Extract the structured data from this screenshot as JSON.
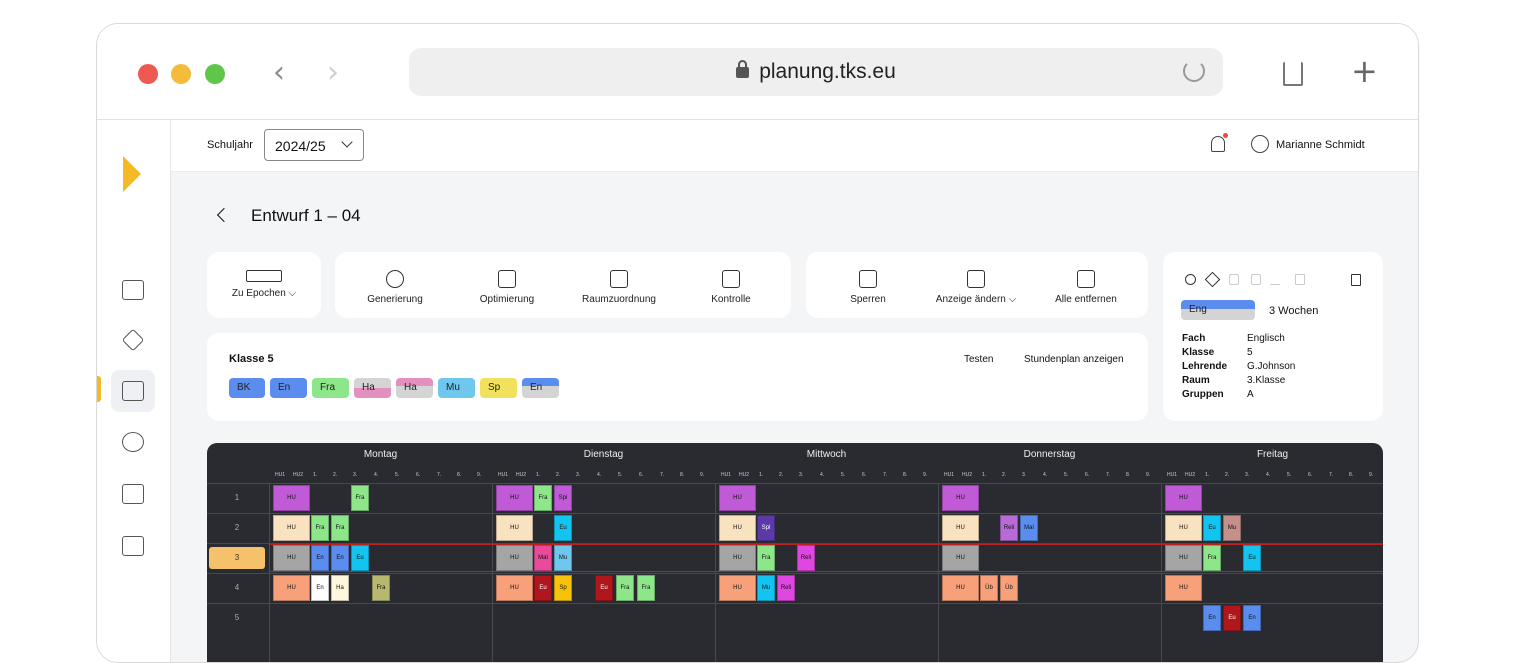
{
  "browser": {
    "url": "planung.tks.eu"
  },
  "topbar": {
    "year_label": "Schuljahr",
    "year_value": "2024/25",
    "user_name": "Marianne Schmidt"
  },
  "page": {
    "title": "Entwurf 1 – 04"
  },
  "toolbar": {
    "group1": [
      {
        "label": "Zu Epochen ⌵"
      }
    ],
    "group2": [
      {
        "label": "Generierung"
      },
      {
        "label": "Optimierung"
      },
      {
        "label": "Raumzuordnung"
      },
      {
        "label": "Kontrolle"
      }
    ],
    "group3": [
      {
        "label": "Sperren"
      },
      {
        "label": "Anzeige ändern ⌵"
      },
      {
        "label": "Alle entfernen"
      }
    ]
  },
  "class_panel": {
    "title": "Klasse 5",
    "actions": [
      "Testen",
      "Stundenplan anzeigen"
    ],
    "subjects": [
      {
        "label": "BK",
        "color": "#5b8def"
      },
      {
        "label": "En",
        "color": "#5b8def"
      },
      {
        "label": "Fra",
        "color": "#8ee68a"
      },
      {
        "label": "Ha",
        "color": "#e38fc0"
      },
      {
        "label": "Ha",
        "color": "#e38fc0"
      },
      {
        "label": "Mu",
        "color": "#6fc7ee"
      },
      {
        "label": "Sp",
        "color": "#f2e15c"
      },
      {
        "label": "En",
        "color": "#5b8def"
      }
    ]
  },
  "detail": {
    "chip": "Eng",
    "duration": "3 Wochen",
    "fields": [
      {
        "key": "Fach",
        "value": "Englisch"
      },
      {
        "key": "Klasse",
        "value": "5"
      },
      {
        "key": "Lehrende",
        "value": "G.Johnson"
      },
      {
        "key": "Raum",
        "value": "3.Klasse"
      },
      {
        "key": "Gruppen",
        "value": "A"
      }
    ]
  },
  "timetable": {
    "days": [
      "Montag",
      "Dienstag",
      "Mittwoch",
      "Donnerstag",
      "Freitag"
    ],
    "columns": [
      "HU1",
      "HU2",
      "1.",
      "2.",
      "3.",
      "4.",
      "5.",
      "6.",
      "7.",
      "8.",
      "9."
    ],
    "rows": [
      "1",
      "2",
      "3",
      "4",
      "5"
    ],
    "entries": [
      {
        "day": 0,
        "row": 0,
        "col": 0,
        "label": "HU",
        "color": "#c15ad6"
      },
      {
        "day": 0,
        "row": 0,
        "col": 4,
        "label": "Fra",
        "color": "#8ee68a"
      },
      {
        "day": 0,
        "row": 1,
        "col": 0,
        "label": "HU",
        "color": "#f9e2c0"
      },
      {
        "day": 0,
        "row": 1,
        "col": 2,
        "label": "Fra",
        "color": "#8ee68a"
      },
      {
        "day": 0,
        "row": 1,
        "col": 3,
        "label": "Fra",
        "color": "#8ee68a"
      },
      {
        "day": 0,
        "row": 2,
        "col": 0,
        "label": "HU",
        "color": "#a5a5a5"
      },
      {
        "day": 0,
        "row": 2,
        "col": 2,
        "label": "En",
        "color": "#5b8def"
      },
      {
        "day": 0,
        "row": 2,
        "col": 3,
        "label": "En",
        "color": "#5b8def"
      },
      {
        "day": 0,
        "row": 2,
        "col": 4,
        "label": "Eu",
        "color": "#13c4f0"
      },
      {
        "day": 0,
        "row": 3,
        "col": 0,
        "label": "HU",
        "color": "#f7a07a"
      },
      {
        "day": 0,
        "row": 3,
        "col": 2,
        "label": "En",
        "color": "#ffffff"
      },
      {
        "day": 0,
        "row": 3,
        "col": 3,
        "label": "Ha",
        "color": "#fff7dd"
      },
      {
        "day": 0,
        "row": 3,
        "col": 5,
        "label": "Fra",
        "color": "#b7b870"
      },
      {
        "day": 1,
        "row": 0,
        "col": 0,
        "label": "HU",
        "color": "#c15ad6"
      },
      {
        "day": 1,
        "row": 0,
        "col": 2,
        "label": "Fra",
        "color": "#8ee68a"
      },
      {
        "day": 1,
        "row": 0,
        "col": 3,
        "label": "Spi",
        "color": "#c15ad6"
      },
      {
        "day": 1,
        "row": 1,
        "col": 0,
        "label": "HU",
        "color": "#f9e2c0"
      },
      {
        "day": 1,
        "row": 1,
        "col": 3,
        "label": "Eu",
        "color": "#13c4f0"
      },
      {
        "day": 1,
        "row": 2,
        "col": 0,
        "label": "HU",
        "color": "#a5a5a5"
      },
      {
        "day": 1,
        "row": 2,
        "col": 2,
        "label": "Mal",
        "color": "#e84b9a"
      },
      {
        "day": 1,
        "row": 2,
        "col": 3,
        "label": "Mu",
        "color": "#6fc7ee"
      },
      {
        "day": 1,
        "row": 3,
        "col": 0,
        "label": "HU",
        "color": "#f7a07a"
      },
      {
        "day": 1,
        "row": 3,
        "col": 2,
        "label": "Eu",
        "color": "#b0171c"
      },
      {
        "day": 1,
        "row": 3,
        "col": 3,
        "label": "Sp",
        "color": "#f7c20a"
      },
      {
        "day": 1,
        "row": 3,
        "col": 5,
        "label": "Eu",
        "color": "#b0171c"
      },
      {
        "day": 1,
        "row": 3,
        "col": 6,
        "label": "Fra",
        "color": "#8ee68a"
      },
      {
        "day": 1,
        "row": 3,
        "col": 7,
        "label": "Fra",
        "color": "#8ee68a"
      },
      {
        "day": 2,
        "row": 0,
        "col": 0,
        "label": "HU",
        "color": "#c15ad6"
      },
      {
        "day": 2,
        "row": 1,
        "col": 0,
        "label": "HU",
        "color": "#f9e2c0"
      },
      {
        "day": 2,
        "row": 1,
        "col": 2,
        "label": "Spl",
        "color": "#5b3aa8"
      },
      {
        "day": 2,
        "row": 2,
        "col": 0,
        "label": "HU",
        "color": "#a5a5a5"
      },
      {
        "day": 2,
        "row": 2,
        "col": 2,
        "label": "Fra",
        "color": "#8ee68a"
      },
      {
        "day": 2,
        "row": 2,
        "col": 4,
        "label": "Reli",
        "color": "#e046e0"
      },
      {
        "day": 2,
        "row": 3,
        "col": 0,
        "label": "HU",
        "color": "#f7a07a"
      },
      {
        "day": 2,
        "row": 3,
        "col": 2,
        "label": "Mu",
        "color": "#13c4f0"
      },
      {
        "day": 2,
        "row": 3,
        "col": 3,
        "label": "Reli",
        "color": "#e046e0"
      },
      {
        "day": 3,
        "row": 0,
        "col": 0,
        "label": "HU",
        "color": "#c15ad6"
      },
      {
        "day": 3,
        "row": 1,
        "col": 0,
        "label": "HU",
        "color": "#f9e2c0"
      },
      {
        "day": 3,
        "row": 1,
        "col": 3,
        "label": "Reli",
        "color": "#b86ad6"
      },
      {
        "day": 3,
        "row": 1,
        "col": 4,
        "label": "Mal",
        "color": "#5b8def"
      },
      {
        "day": 3,
        "row": 2,
        "col": 0,
        "label": "HU",
        "color": "#a5a5a5"
      },
      {
        "day": 3,
        "row": 3,
        "col": 0,
        "label": "HU",
        "color": "#f7a07a"
      },
      {
        "day": 3,
        "row": 3,
        "col": 2,
        "label": "Üb",
        "color": "#f7a07a"
      },
      {
        "day": 3,
        "row": 3,
        "col": 3,
        "label": "Üb",
        "color": "#f7a07a"
      },
      {
        "day": 4,
        "row": 0,
        "col": 0,
        "label": "HU",
        "color": "#c15ad6"
      },
      {
        "day": 4,
        "row": 1,
        "col": 0,
        "label": "HU",
        "color": "#f9e2c0"
      },
      {
        "day": 4,
        "row": 1,
        "col": 2,
        "label": "Eu",
        "color": "#13c4f0"
      },
      {
        "day": 4,
        "row": 1,
        "col": 3,
        "label": "Mu",
        "color": "#c49089"
      },
      {
        "day": 4,
        "row": 2,
        "col": 0,
        "label": "HU",
        "color": "#a5a5a5"
      },
      {
        "day": 4,
        "row": 2,
        "col": 2,
        "label": "Fra",
        "color": "#8ee68a"
      },
      {
        "day": 4,
        "row": 2,
        "col": 4,
        "label": "Eu",
        "color": "#13c4f0"
      },
      {
        "day": 4,
        "row": 3,
        "col": 0,
        "label": "HU",
        "color": "#f7a07a"
      },
      {
        "day": 4,
        "row": 4,
        "col": 2,
        "label": "En",
        "color": "#5b8def"
      },
      {
        "day": 4,
        "row": 4,
        "col": 3,
        "label": "Eu",
        "color": "#b0171c"
      },
      {
        "day": 4,
        "row": 4,
        "col": 4,
        "label": "En",
        "color": "#5b8def"
      }
    ]
  }
}
